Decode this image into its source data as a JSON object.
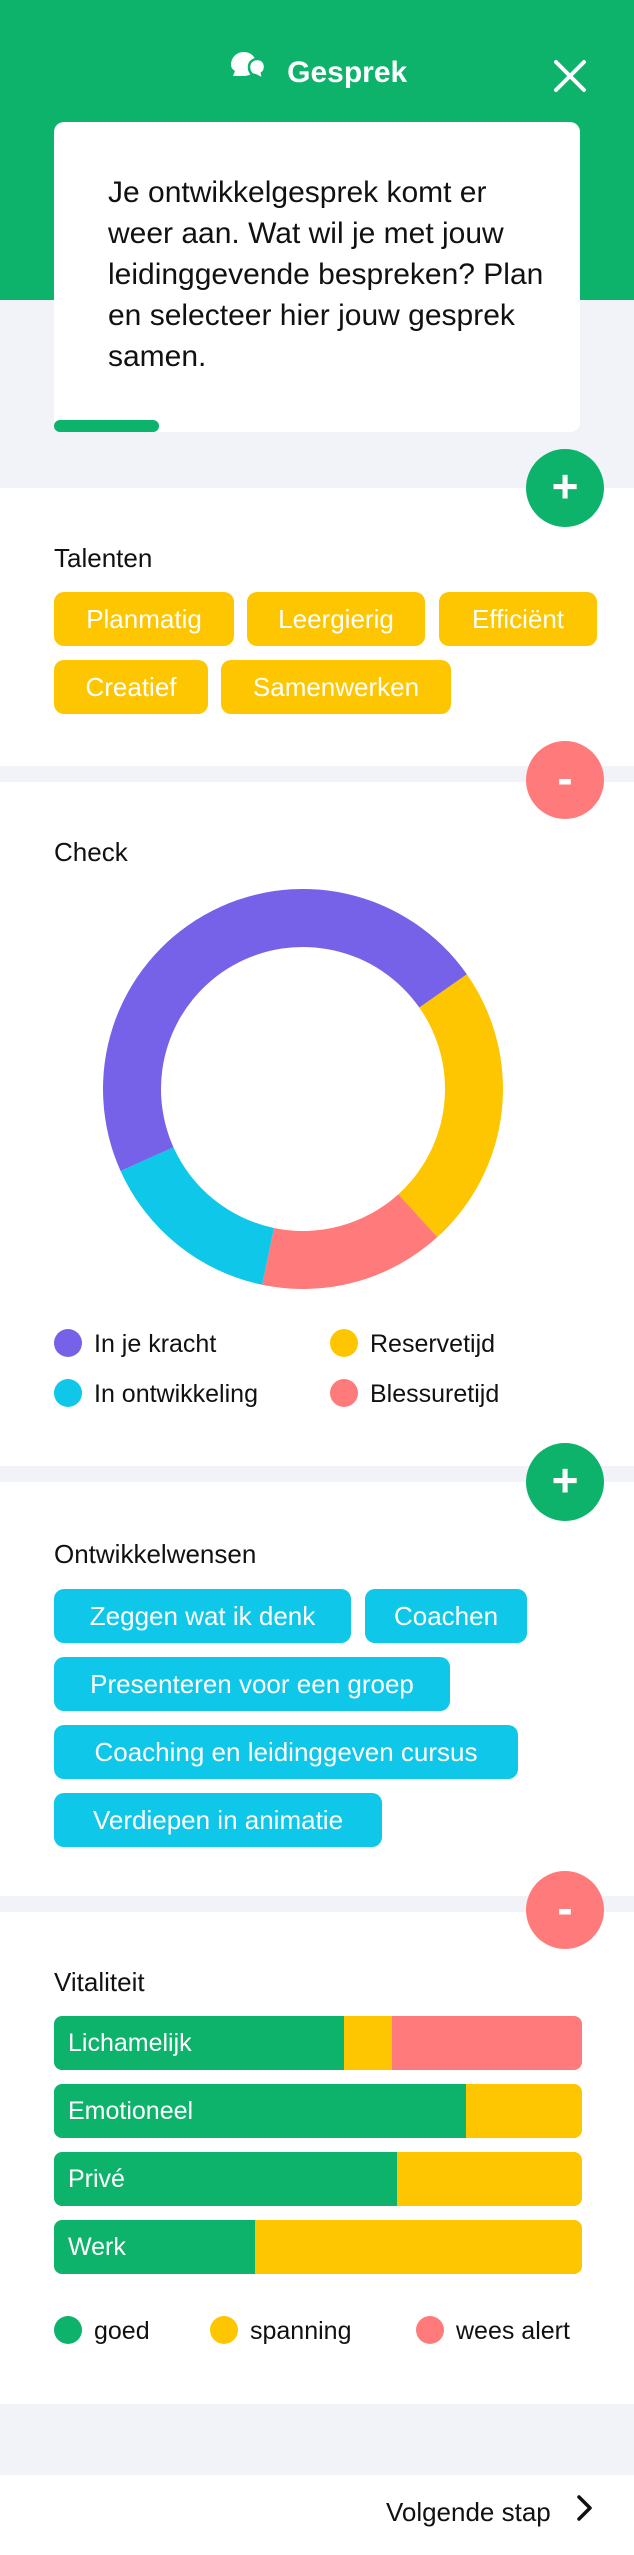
{
  "header": {
    "title": "Gesprek",
    "logo_icon": "chat-bubbles-icon",
    "close_icon": "close-icon"
  },
  "intro": {
    "text": "Je ontwikkelgesprek komt er weer aan. Wat wil je met jouw leidinggevende bespreken? Plan en selecteer hier jouw gesprek samen.",
    "progress": 0.2
  },
  "talenten": {
    "title": "Talenten",
    "chips": [
      "Planmatig",
      "Leergierig",
      "Efficiënt",
      "Creatief",
      "Samenwerken"
    ],
    "action": "+"
  },
  "check": {
    "title": "Check",
    "action": "-",
    "legend": [
      "In je kracht",
      "Reservetijd",
      "In ontwikkeling",
      "Blessuretijd"
    ]
  },
  "chart_data": {
    "type": "pie",
    "donut": true,
    "categories": [
      "In je kracht",
      "Reservetijd",
      "Blessuretijd",
      "In ontwikkeling"
    ],
    "values": [
      47,
      23,
      15,
      15
    ],
    "colors": [
      "#7562e8",
      "#fec600",
      "#ff7b7b",
      "#0fc7e8"
    ]
  },
  "ontwikkelwensen": {
    "title": "Ontwikkelwensen",
    "action": "+",
    "chips": [
      "Zeggen wat ik denk",
      "Coachen",
      "Presenteren voor een groep",
      "Coaching en leidinggeven cursus",
      "Verdiepen in animatie"
    ]
  },
  "vitaliteit": {
    "title": "Vitaliteit",
    "action": "-",
    "rows": [
      {
        "label": "Lichamelijk",
        "goed": 0.55,
        "spanning": 0.09,
        "alert": 0.36
      },
      {
        "label": "Emotioneel",
        "goed": 0.78,
        "spanning": 0.22,
        "alert": 0
      },
      {
        "label": "Privé",
        "goed": 0.65,
        "spanning": 0.35,
        "alert": 0
      },
      {
        "label": "Werk",
        "goed": 0.38,
        "spanning": 0.62,
        "alert": 0
      }
    ],
    "legend": [
      "goed",
      "spanning",
      "wees alert"
    ]
  },
  "colors": {
    "green": "#0db36a",
    "yellow": "#fec600",
    "red": "#ff7b7b",
    "purple": "#7562e8",
    "cyan": "#0fc7e8"
  },
  "footer": {
    "next_label": "Volgende stap",
    "next_icon": "chevron-right-icon"
  }
}
